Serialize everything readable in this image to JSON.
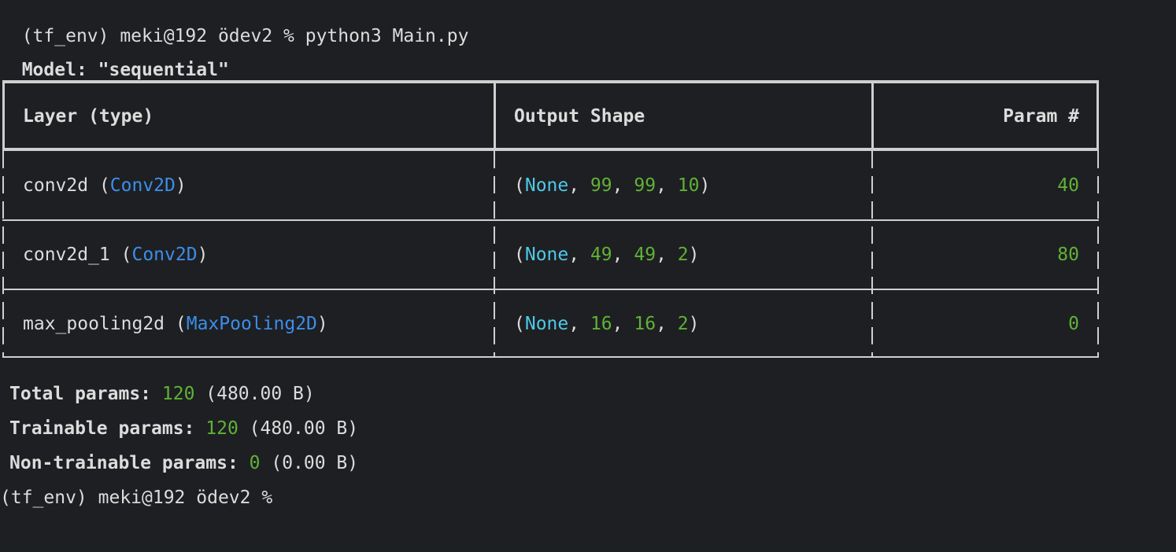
{
  "terminal": {
    "command_line": {
      "prompt": "(tf_env) meki@192 ödev2 % ",
      "command": "python3 Main.py"
    },
    "model_line": {
      "prefix": "Model: ",
      "name": "\"sequential\""
    },
    "table": {
      "headers": [
        "Layer (type)",
        "Output Shape",
        "Param #"
      ],
      "rows": [
        {
          "layer_name": "conv2d",
          "layer_type": "Conv2D",
          "shape_none": "None",
          "shape_dims": [
            "99",
            "99",
            "10"
          ],
          "params": "40"
        },
        {
          "layer_name": "conv2d_1",
          "layer_type": "Conv2D",
          "shape_none": "None",
          "shape_dims": [
            "49",
            "49",
            "2"
          ],
          "params": "80"
        },
        {
          "layer_name": "max_pooling2d",
          "layer_type": "MaxPooling2D",
          "shape_none": "None",
          "shape_dims": [
            "16",
            "16",
            "2"
          ],
          "params": "0"
        }
      ]
    },
    "summary": {
      "total": {
        "label": "Total params: ",
        "value": "120",
        "size": " (480.00 B)"
      },
      "trainable": {
        "label": "Trainable params: ",
        "value": "120",
        "size": " (480.00 B)"
      },
      "non_trainable": {
        "label": "Non-trainable params: ",
        "value": "0",
        "size": " (0.00 B)"
      }
    },
    "final_prompt": "(tf_env) meki@192 ödev2 % "
  },
  "colors": {
    "background": "#1e1f22",
    "text": "#dcdcdc",
    "number": "#5fb236",
    "type": "#3b8eea",
    "none": "#4fc7e8",
    "border": "#cfcfcf"
  }
}
